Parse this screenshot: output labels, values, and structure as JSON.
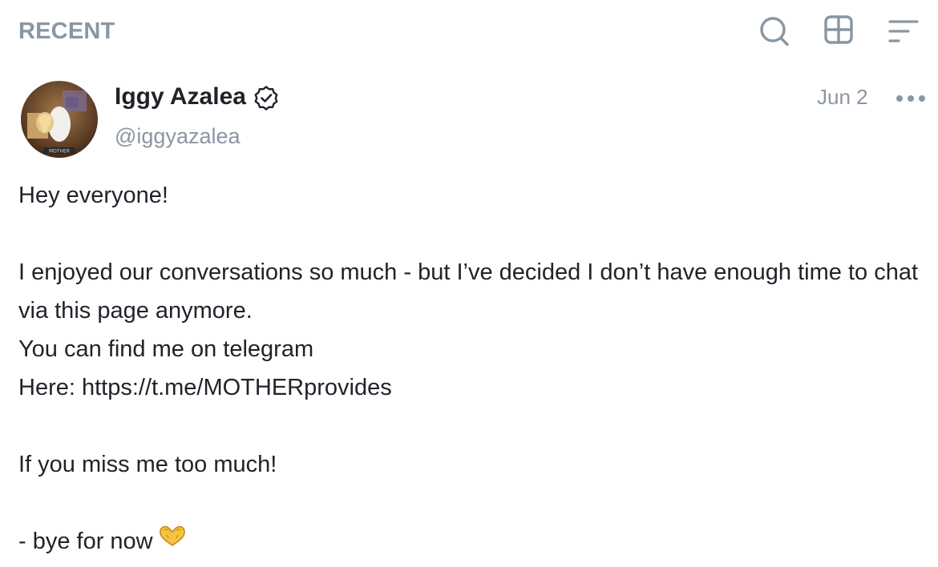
{
  "header": {
    "title": "RECENT",
    "icons": [
      "search-icon",
      "grid-view-icon",
      "sort-icon"
    ]
  },
  "post": {
    "author": {
      "name": "Iggy Azalea",
      "handle": "@iggyazalea",
      "verified": true,
      "avatar_caption": "MOTHER"
    },
    "date": "Jun 2",
    "body": {
      "line1": "Hey everyone!",
      "line2": "I enjoyed our conversations so much - but I’ve decided I don’t have enough time to chat via this page anymore.",
      "line3": "You can find me on telegram",
      "line4": "Here: https://t.me/MOTHERprovides",
      "line5": "If you miss me too much!",
      "line6": "- bye for now"
    },
    "emoji": "heart-hands"
  },
  "colors": {
    "muted": "#8a96a3",
    "text": "#1f2329",
    "background": "#ffffff",
    "emoji": "#f5c342"
  }
}
